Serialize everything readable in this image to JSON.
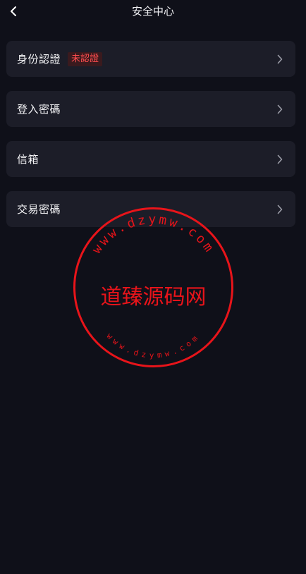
{
  "header": {
    "title": "安全中心",
    "back_icon": "chevron-left-icon"
  },
  "menu": {
    "items": [
      {
        "label": "身份認證",
        "badge": "未認證",
        "chevron_icon": "chevron-right-icon"
      },
      {
        "label": "登入密碼",
        "chevron_icon": "chevron-right-icon"
      },
      {
        "label": "信箱",
        "chevron_icon": "chevron-right-icon"
      },
      {
        "label": "交易密碼",
        "chevron_icon": "chevron-right-icon"
      }
    ]
  },
  "watermark": {
    "center_text": "道臻源码网",
    "outer_ring_text": "www.dzymw.com",
    "inner_ring_text": "www.dzymw.com",
    "color": "#e8141a"
  },
  "colors": {
    "background": "#0f1019",
    "card": "#1c1d28",
    "badge_text": "#ff4d4f",
    "badge_bg": "#3a1a1e"
  }
}
